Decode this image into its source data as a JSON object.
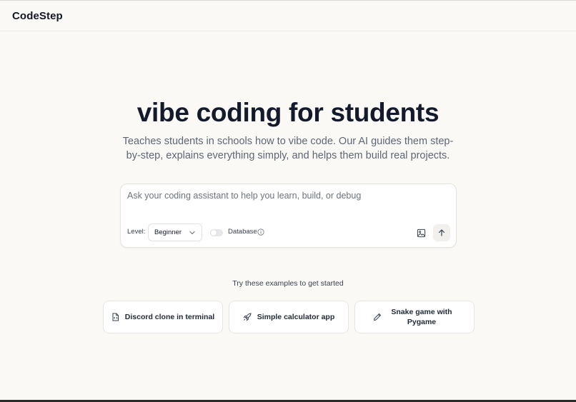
{
  "header": {
    "logo": "CodeStep"
  },
  "hero": {
    "title": "vibe coding for students",
    "subtitle": "Teaches students in schools how to vibe code. Our AI guides them step-by-step, explains everything simply, and helps them build real projects."
  },
  "prompt": {
    "placeholder": "Ask your coding assistant to help you learn, build, or debug",
    "value": "",
    "level_label": "Level:",
    "level_value": "Beginner",
    "database_label": "Database",
    "database_enabled": false
  },
  "examples": {
    "title": "Try these examples to get started",
    "items": [
      {
        "label": "Discord clone in terminal",
        "icon": "file-code-icon"
      },
      {
        "label": "Simple calculator app",
        "icon": "rocket-icon"
      },
      {
        "label": "Snake game with Pygame",
        "icon": "pencil-icon"
      }
    ]
  },
  "colors": {
    "background": "#faf9f6",
    "title": "#131a2b",
    "muted": "#5d6675"
  }
}
